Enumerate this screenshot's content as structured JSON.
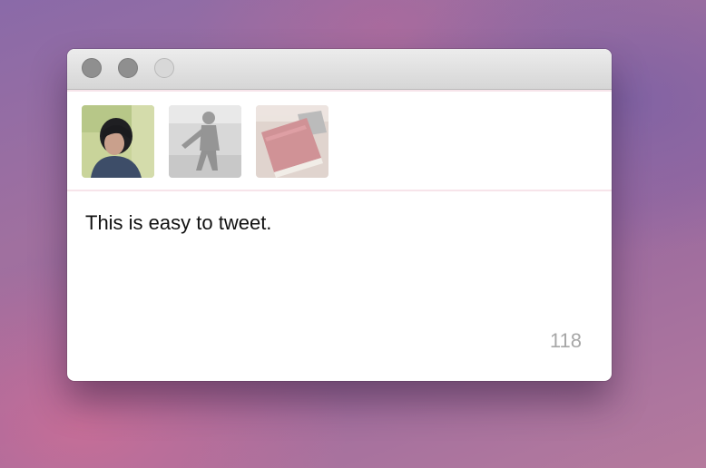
{
  "window": {
    "controls": [
      "close",
      "minimize",
      "zoom"
    ]
  },
  "accounts": [
    {
      "icon": "person-avatar-icon",
      "selected": true
    },
    {
      "icon": "person-avatar-icon",
      "selected": false
    },
    {
      "icon": "book-avatar-icon",
      "selected": false
    }
  ],
  "compose": {
    "text": "This is easy to tweet.",
    "remaining_chars": "118"
  },
  "colors": {
    "divider": "#f7e4ea",
    "counter": "#a7a7a7"
  }
}
